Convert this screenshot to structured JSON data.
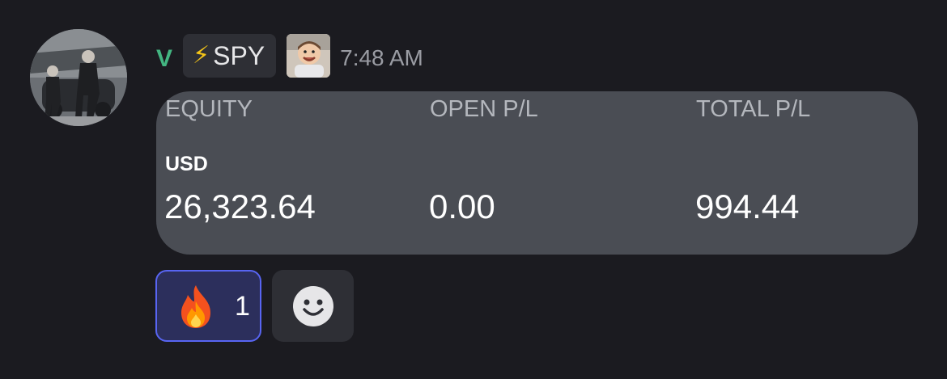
{
  "message": {
    "username": "V",
    "role_tag": {
      "icon": "lightning-bolt-icon",
      "name": "SPY"
    },
    "timestamp": "7:48 AM",
    "username_color": "#43b581"
  },
  "embed": {
    "columns": [
      {
        "label": "EQUITY",
        "value": "26,323.64"
      },
      {
        "label": "OPEN P/L",
        "value": "0.00"
      },
      {
        "label": "TOTAL P/L",
        "value": "994.44"
      }
    ],
    "currency": "USD"
  },
  "reactions": [
    {
      "emoji": "fire-icon",
      "count": "1",
      "active": true
    }
  ],
  "add_reaction_icon": "smiley-face-icon",
  "colors": {
    "background": "#1b1b20",
    "card": "#4a4d54",
    "accent": "#5865f2"
  }
}
